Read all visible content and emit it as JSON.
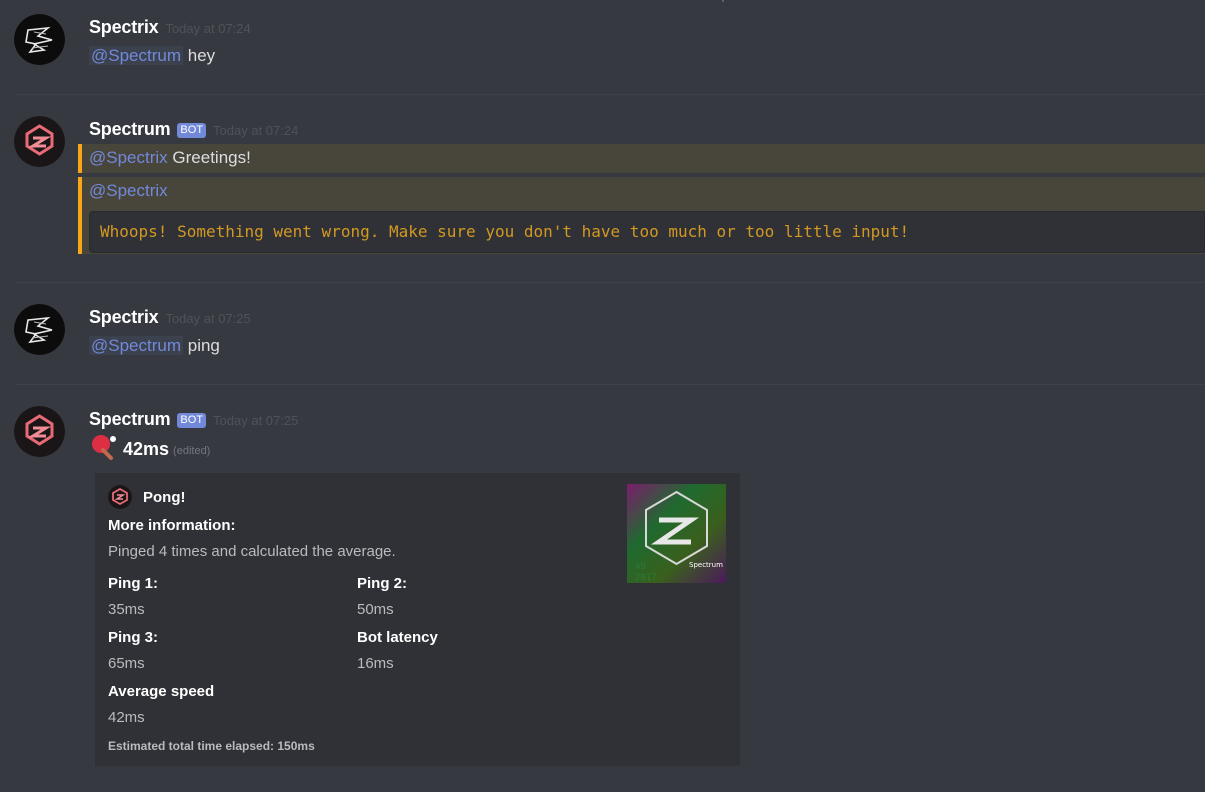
{
  "messages": [
    {
      "author": "Spectrix",
      "timestamp": "Today at 07:24",
      "mention": "@Spectrum",
      "text": "hey"
    },
    {
      "author": "Spectrum",
      "bot_tag": "BOT",
      "timestamp": "Today at 07:24",
      "reply_mention": "@Spectrix",
      "reply_text": "Greetings!",
      "mention2": "@Spectrix",
      "error_code": "Whoops! Something went wrong. Make sure you don't have too much or too little input!"
    },
    {
      "author": "Spectrix",
      "timestamp": "Today at 07:25",
      "mention": "@Spectrum",
      "text": "ping"
    },
    {
      "author": "Spectrum",
      "bot_tag": "BOT",
      "timestamp": "Today at 07:25",
      "emoji": "ping-pong-icon",
      "ms_text": "42ms",
      "edited": "(edited)",
      "embed": {
        "author": "Pong!",
        "description_title": "More information:",
        "description": "Pinged 4 times and calculated the average.",
        "fields": [
          {
            "name": "Ping 1:",
            "value": "35ms"
          },
          {
            "name": "Ping 2:",
            "value": "50ms"
          },
          {
            "name": "Ping 3:",
            "value": "65ms"
          },
          {
            "name": "Bot latency",
            "value": "16ms"
          },
          {
            "name": "Average speed",
            "value": "42ms"
          }
        ],
        "footer": "Estimated total time elapsed: 150ms",
        "thumbnail_text": "Spectrum",
        "thumbnail_corner": "49\n2017"
      }
    }
  ],
  "colors": {
    "background": "#36393f",
    "mention": "#7289da",
    "highlight_border": "#faa61a",
    "code_text": "#d29922"
  }
}
